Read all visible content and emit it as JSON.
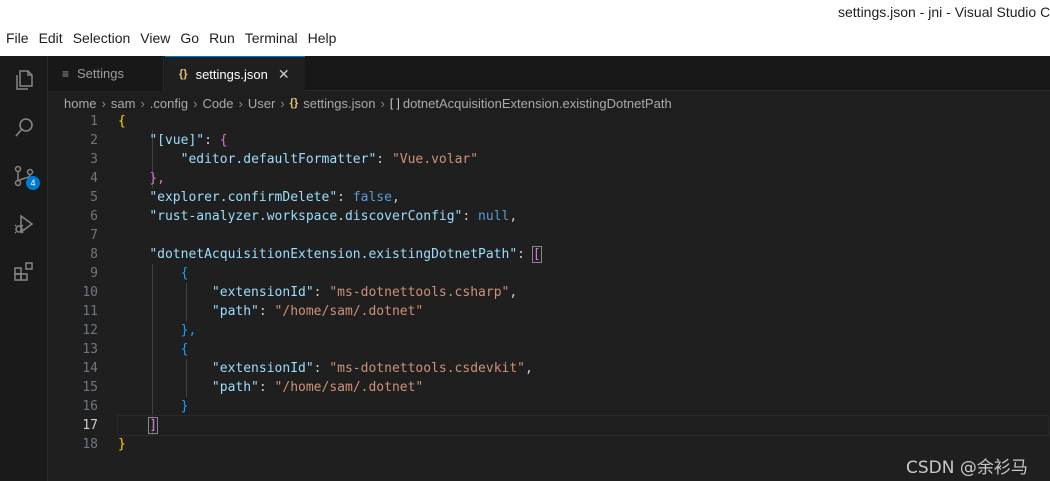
{
  "window": {
    "title": "settings.json - jni - Visual Studio C"
  },
  "menu": [
    "File",
    "Edit",
    "Selection",
    "View",
    "Go",
    "Run",
    "Terminal",
    "Help"
  ],
  "activity": {
    "scm_badge": "4"
  },
  "tabs": {
    "settings": "Settings",
    "json": "settings.json",
    "close": "✕"
  },
  "breadcrumb": [
    "home",
    "sam",
    ".config",
    "Code",
    "User",
    "settings.json",
    "dotnetAcquisitionExtension.existingDotnetPath"
  ],
  "editor": {
    "line_numbers": [
      "1",
      "2",
      "3",
      "4",
      "5",
      "6",
      "7",
      "8",
      "9",
      "10",
      "11",
      "12",
      "13",
      "14",
      "15",
      "16",
      "17",
      "18"
    ],
    "active_line": 17,
    "lines": {
      "l1_open": "{",
      "l2_key": "\"[vue]\"",
      "l2_open": "{",
      "l3_key": "\"editor.defaultFormatter\"",
      "l3_val": "\"Vue.volar\"",
      "l4_close": "},",
      "l5_key": "\"explorer.confirmDelete\"",
      "l5_val": "false",
      "l6_key": "\"rust-analyzer.workspace.discoverConfig\"",
      "l6_val": "null",
      "l8_key": "\"dotnetAcquisitionExtension.existingDotnetPath\"",
      "l8_open": "[",
      "l9_open": "{",
      "l10_key": "\"extensionId\"",
      "l10_val": "\"ms-dotnettools.csharp\"",
      "l11_key": "\"path\"",
      "l11_val": "\"/home/sam/.dotnet\"",
      "l12_close": "},",
      "l13_open": "{",
      "l14_key": "\"extensionId\"",
      "l14_val": "\"ms-dotnettools.csdevkit\"",
      "l15_key": "\"path\"",
      "l15_val": "\"/home/sam/.dotnet\"",
      "l16_close": "}",
      "l17_close": "]",
      "l18_close": "}"
    }
  },
  "watermark": "CSDN @余衫马",
  "colors": {
    "accent": "#0078d4",
    "json_icon": "#e5c07b",
    "key": "#9cdcfe",
    "string": "#ce9178",
    "keyword": "#569cd6"
  }
}
